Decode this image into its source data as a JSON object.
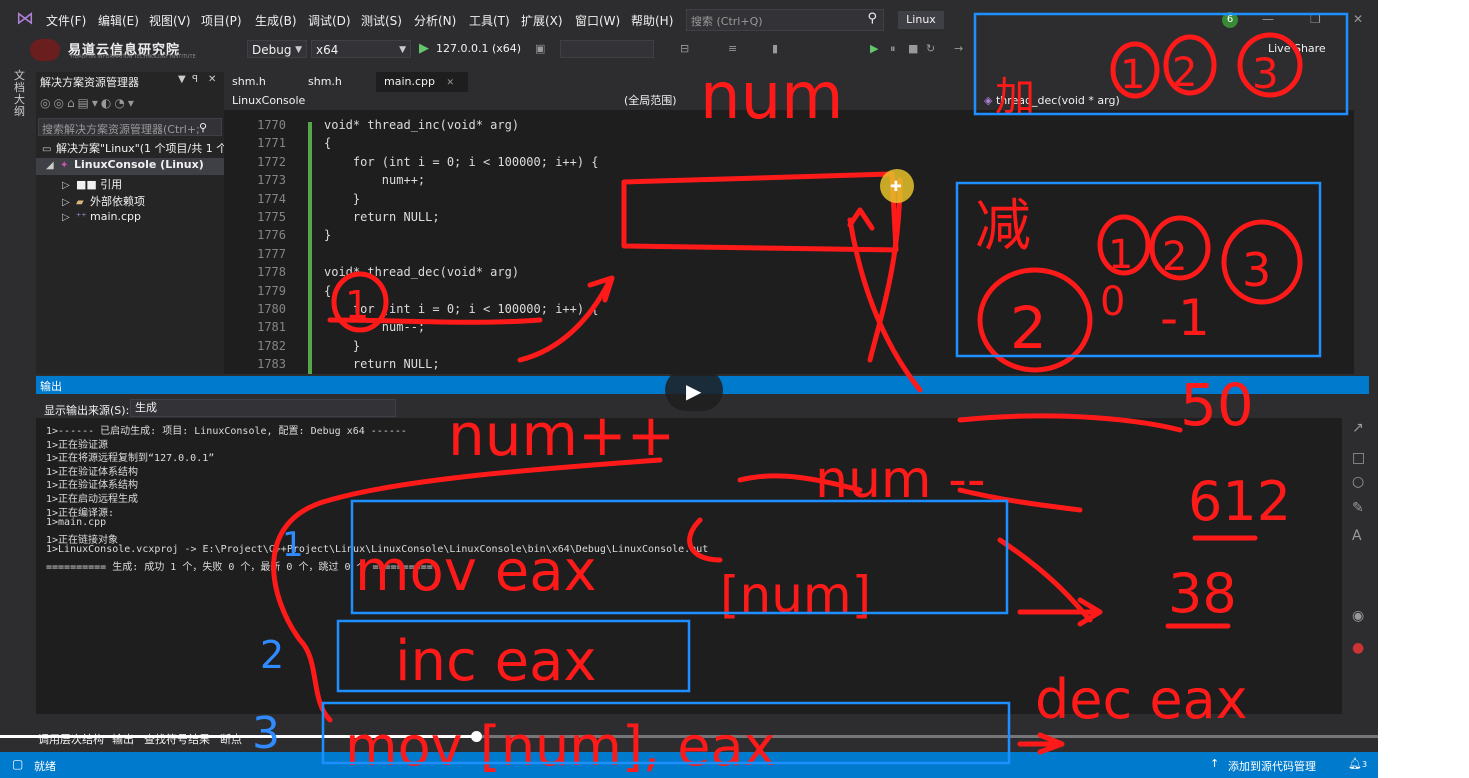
{
  "menu": {
    "items": [
      "文件(F)",
      "编辑(E)",
      "视图(V)",
      "项目(P)",
      "生成(B)",
      "调试(D)",
      "测试(S)",
      "分析(N)",
      "工具(T)",
      "扩展(X)",
      "窗口(W)",
      "帮助(H)"
    ],
    "search_placeholder": "搜索 (Ctrl+Q)",
    "project_badge": "Linux",
    "notification_count": "6"
  },
  "toolbar": {
    "config": "Debug",
    "platform": "x64",
    "run_target": "127.0.0.1 (x64)",
    "brand": "易道云信息研究院",
    "brand_sub": "YIDAOYUN INFORMATION TECHNOLOGY INSTITUTE",
    "live_share": "Live Share"
  },
  "side_strip": {
    "label": "文档大纲"
  },
  "solution_explorer": {
    "title": "解决方案资源管理器",
    "search_placeholder": "搜索解决方案资源管理器(Ctrl+;",
    "tree": [
      {
        "label": "解决方案\"Linux\"(1 个项目/共 1 个",
        "indent": 0
      },
      {
        "label": "LinuxConsole (Linux)",
        "indent": 1
      },
      {
        "label": "■■ 引用",
        "indent": 2
      },
      {
        "label": "外部依赖项",
        "indent": 2
      },
      {
        "label": "main.cpp",
        "indent": 2
      }
    ]
  },
  "editor": {
    "tabs": [
      "shm.h",
      "shm.h",
      "main.cpp"
    ],
    "nav_project": "LinuxConsole",
    "nav_scope": "(全局范围)",
    "nav_member": "thread_dec(void * arg)",
    "lines": [
      {
        "n": "1770",
        "code": "void* thread_inc(void* arg)"
      },
      {
        "n": "1771",
        "code": "{"
      },
      {
        "n": "1772",
        "code": "    for (int i = 0; i < 100000; i++) {"
      },
      {
        "n": "1773",
        "code": "        num++;"
      },
      {
        "n": "1774",
        "code": "    }"
      },
      {
        "n": "1775",
        "code": "    return NULL;"
      },
      {
        "n": "1776",
        "code": "}"
      },
      {
        "n": "1777",
        "code": ""
      },
      {
        "n": "1778",
        "code": "void* thread_dec(void* arg)"
      },
      {
        "n": "1779",
        "code": "{"
      },
      {
        "n": "1780",
        "code": "    for (int i = 0; i < 100000; i++) {"
      },
      {
        "n": "1781",
        "code": "        num--;"
      },
      {
        "n": "1782",
        "code": "    }"
      },
      {
        "n": "1783",
        "code": "    return NULL;"
      }
    ]
  },
  "output": {
    "title": "输出",
    "source_label": "显示输出来源(S):",
    "source_value": "生成",
    "lines": [
      "1>------ 已启动生成: 项目: LinuxConsole, 配置: Debug x64 ------",
      "1>正在验证源",
      "1>正在将源远程复制到“127.0.0.1”",
      "1>正在验证体系结构",
      "1>正在验证体系结构",
      "1>正在启动远程生成",
      "1>正在编译源:",
      "1>main.cpp",
      "1>正在链接对象",
      "1>LinuxConsole.vcxproj -> E:\\Project\\C++Project\\Linux\\LinuxConsole\\LinuxConsole\\bin\\x64\\Debug\\LinuxConsole.out",
      "========== 生成: 成功 1 个，失败 0 个，最新 0 个，跳过 0 个 =========="
    ]
  },
  "bottom_tabs": [
    "调用层次结构",
    "输出",
    "查找符号结果",
    "断点"
  ],
  "status": {
    "ready": "就绪",
    "source_control": "添加到源代码管理",
    "bell_count": "3"
  },
  "video": {
    "progress": 0.324
  },
  "annotations": {
    "num_top": "num",
    "num_inc": "num++",
    "num_minus": "num --",
    "mov_eax": "mov eax",
    "num_bracket": "[num]",
    "inc_eax": "inc eax",
    "mov_num_eax": "mov [num], eax",
    "dec_eax": "dec eax",
    "step1": "1",
    "step2": "2",
    "step3": "3",
    "val_50": "50",
    "val_612": "612",
    "val_38": "38",
    "zero": "0",
    "minus_one": "-1",
    "jian": "减",
    "jia": "加"
  },
  "colors": {
    "accent": "#007acc",
    "ink_red": "#ff1a1a",
    "box_blue": "#1e8fff"
  }
}
